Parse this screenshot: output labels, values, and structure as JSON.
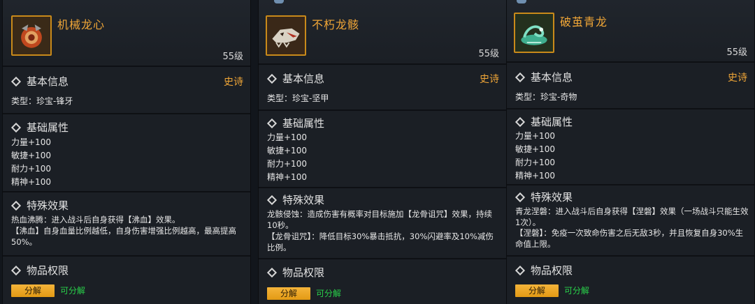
{
  "labels": {
    "basic_info": "基本信息",
    "base_attrs": "基础属性",
    "special": "特殊效果",
    "permission": "物品权限",
    "dismantle_button": "分解",
    "dismantle_status": "可分解"
  },
  "cards": [
    {
      "name": "机械龙心",
      "level": "55级",
      "rarity": "史诗",
      "type": "类型：珍宝-锋牙",
      "attrs": [
        "力量+100",
        "敏捷+100",
        "耐力+100",
        "精神+100"
      ],
      "effects": [
        "热血沸腾：进入战斗后自身获得【沸血】效果。",
        "【沸血】自身血量比例越低，自身伤害增强比例越高，最高提高50%。"
      ],
      "icon": "mech-dragon-heart-icon"
    },
    {
      "name": "不朽龙骸",
      "level": "55级",
      "rarity": "史诗",
      "type": "类型：珍宝-坚甲",
      "attrs": [
        "力量+100",
        "敏捷+100",
        "耐力+100",
        "精神+100"
      ],
      "effects": [
        "龙骸侵蚀：造成伤害有概率对目标施加【龙骨诅咒】效果，持续10秒。",
        "【龙骨诅咒】：降低目标30%暴击抵抗，30%闪避率及10%减伤比例。"
      ],
      "icon": "dragon-skull-icon"
    },
    {
      "name": "破茧青龙",
      "level": "55级",
      "rarity": "史诗",
      "type": "类型：珍宝-奇物",
      "attrs": [
        "力量+100",
        "敏捷+100",
        "耐力+100",
        "精神+100"
      ],
      "effects": [
        "青龙涅磐：进入战斗后自身获得【涅磐】效果（一场战斗只能生效1次）。",
        "【涅磐】：免疫一次致命伤害之后无敌3秒，并且恢复自身30%生命值上限。"
      ],
      "icon": "azure-dragon-icon"
    }
  ],
  "colors": {
    "rarity": "#f0a637",
    "dismantle_ok": "#29d14a",
    "button": "#f0aa2a"
  }
}
